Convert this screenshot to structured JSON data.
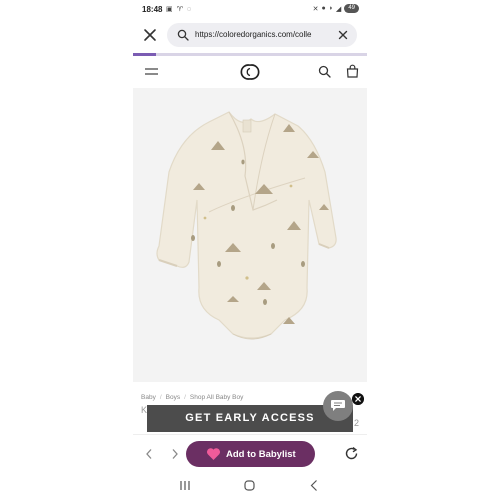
{
  "status_bar": {
    "time": "18:48",
    "left_icons": [
      "message-icon",
      "wifi-calling-icon",
      "whatsapp-icon"
    ],
    "right_icons": [
      "mute-icon",
      "location-icon",
      "wifi-icon",
      "signal-icon",
      "battery-icon"
    ],
    "battery_level": "49"
  },
  "browser": {
    "url": "https://coloredorganics.com/colle",
    "load_progress": 0.1
  },
  "site_header": {
    "logo": "colored-organics-logo",
    "menu_icon": "hamburger-menu-icon",
    "search_icon": "search-icon",
    "bag_icon": "shopping-bag-icon"
  },
  "product": {
    "image_alt": "baby-kimono-bodysuit-image"
  },
  "breadcrumb": {
    "items": [
      "Baby",
      "Boys",
      "Shop All Baby Boy"
    ],
    "title_peek": "K",
    "price_peek": "2"
  },
  "promo": {
    "early_access_label": "GET EARLY ACCESS"
  },
  "bottom_toolbar": {
    "add_to_babylist_label": "Add to Babylist"
  },
  "colors": {
    "promo_bar": "#4c4c4c",
    "babylist_button": "#6b2f63",
    "heart": "#f05b9a",
    "progress": "#7b5cb3"
  }
}
